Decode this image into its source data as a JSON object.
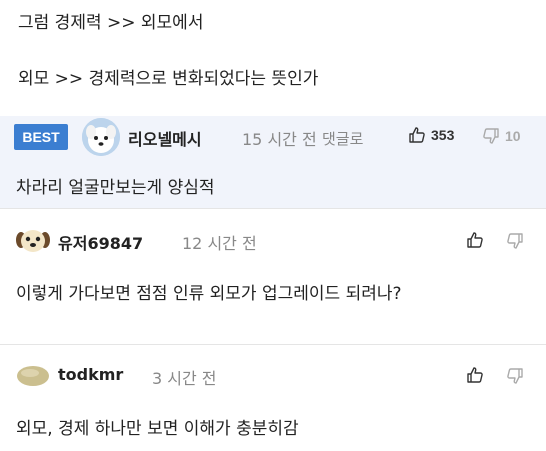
{
  "post": {
    "lines": [
      "그럼 경제력 >> 외모에서",
      "외모 >> 경제력으로 변화되었다는 뜻인가"
    ]
  },
  "comments": [
    {
      "badge": "BEST",
      "username": "리오넬메시",
      "avatar_icon": "white-puppy-avatar-icon",
      "time": "15 시간 전",
      "reply_label": "댓글로",
      "likes": "353",
      "dislikes": "10",
      "text": "차라리 얼굴만보는게 양심적"
    },
    {
      "username": "유저69847",
      "avatar_icon": "puppy-face-avatar-icon",
      "time": "12 시간 전",
      "text": "이렇게 가다보면 점점 인류 외모가 업그레이드 되려나?"
    },
    {
      "username": "todkmr",
      "avatar_icon": "beige-blob-avatar-icon",
      "time": "3 시간 전",
      "text": "외모, 경제 하나만 보면 이해가 충분히감"
    }
  ],
  "colors": {
    "best_badge": "#3b7ed1",
    "best_background": "#f1f4fb",
    "muted_text": "#888888"
  }
}
